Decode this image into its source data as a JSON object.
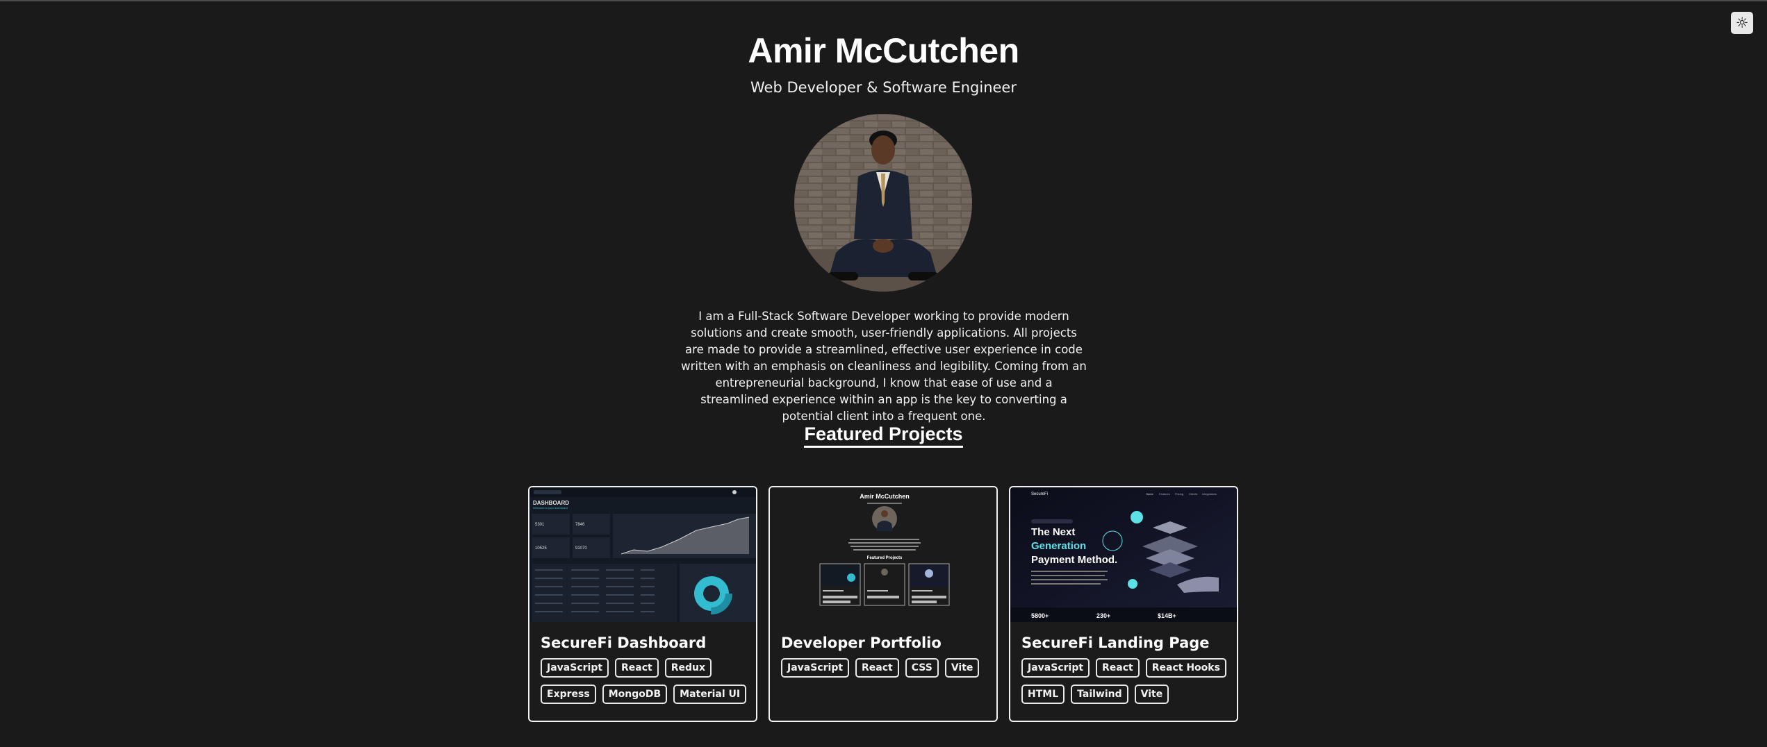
{
  "header": {
    "name": "Amir McCutchen",
    "subtitle": "Web Developer & Software Engineer",
    "theme_toggle_icon": "sun-icon"
  },
  "bio": "I am a Full-Stack Software Developer working to provide modern solutions and create smooth, user-friendly applications. All projects are made to provide a streamlined, effective user experience in code written with an emphasis on cleanliness and legibility. Coming from an entrepreneurial background, I know that ease of use and a streamlined experience within an app is the key to converting a potential client into a frequent one.",
  "section_title": "Featured Projects",
  "projects": [
    {
      "title": "SecureFi Dashboard",
      "tags": [
        "JavaScript",
        "React",
        "Redux",
        "Express",
        "MongoDB",
        "Material UI"
      ]
    },
    {
      "title": "Developer Portfolio",
      "tags": [
        "JavaScript",
        "React",
        "CSS",
        "Vite"
      ]
    },
    {
      "title": "SecureFi Landing Page",
      "tags": [
        "JavaScript",
        "React",
        "React Hooks",
        "HTML",
        "Tailwind",
        "Vite"
      ]
    }
  ],
  "thumbnails": {
    "dashboard": {
      "heading": "DASHBOARD",
      "stats": [
        "5301",
        "7846",
        "10525",
        "91070"
      ]
    },
    "portfolio": {
      "name": "Amir McCutchen",
      "section": "Featured Projects"
    },
    "landing": {
      "brand": "SecureFi",
      "nav": [
        "Home",
        "Features",
        "Pricing",
        "Clients",
        "Integrations"
      ],
      "headline_1": "The Next",
      "headline_2": "Generation",
      "headline_3": "Payment Method.",
      "stats": [
        "5800+",
        "230+",
        "$14B+"
      ]
    }
  },
  "colors": {
    "background": "#1a1a1a",
    "text": "#f2f2f2",
    "accent_teal": "#33bbcf"
  }
}
